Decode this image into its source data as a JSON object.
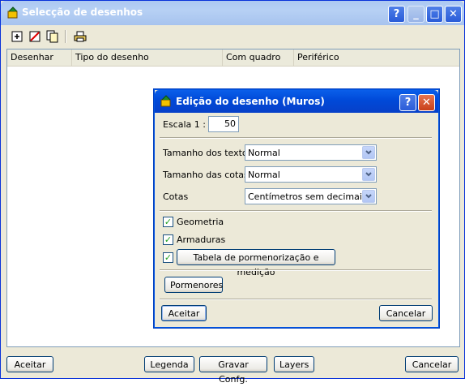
{
  "main_window": {
    "title": "Selecção de desenhos",
    "help_label": "?",
    "minimize_label": "_",
    "maximize_label": "□",
    "close_label": "✕"
  },
  "toolbar": {
    "add_icon": "add-drawing-icon",
    "delete_icon": "delete-drawing-icon",
    "copy_icon": "copy-drawing-icon",
    "print_icon": "print-icon"
  },
  "list": {
    "columns": [
      "Desenhar",
      "Tipo do desenho",
      "Com quadro",
      "Periférico"
    ]
  },
  "dialog": {
    "title": "Edição do desenho (Muros)",
    "help_label": "?",
    "close_label": "✕",
    "scale_label": "Escala 1 :",
    "scale_value": "50",
    "text_size_label": "Tamanho dos textos",
    "text_size_value": "Normal",
    "dim_size_label": "Tamanho das cotas",
    "dim_size_value": "Normal",
    "dims_label": "Cotas",
    "dims_value": "Centímetros sem decimais",
    "geometry_label": "Geometria",
    "geometry_checked": true,
    "rebar_label": "Armaduras",
    "rebar_checked": true,
    "table_checked": true,
    "table_button_label": "Tabela de pormenorização e medição",
    "details_button_label": "Pormenores",
    "ok_label": "Aceitar",
    "cancel_label": "Cancelar"
  },
  "footer": {
    "ok_label": "Aceitar",
    "legend_label": "Legenda",
    "save_config_label": "Gravar Confg.",
    "layers_label": "Layers",
    "cancel_label": "Cancelar"
  }
}
